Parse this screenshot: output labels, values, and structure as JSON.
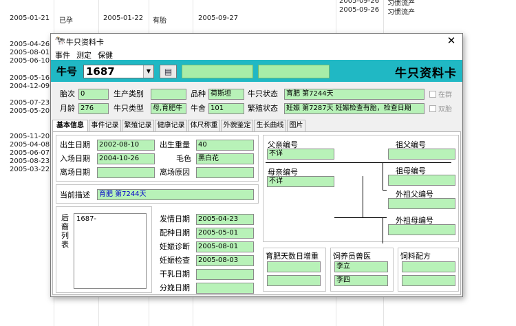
{
  "background": {
    "rows": [
      {
        "a": "2005-01-21",
        "b": "已孕",
        "c": "2005-01-22",
        "d": "有胎",
        "e": "2005-09-27"
      },
      {
        "a": "2005-04-26"
      },
      {
        "a": "2005-08-01"
      },
      {
        "a": "2005-06-10"
      },
      {
        "a": "2005-05-16"
      },
      {
        "a": "2004-12-09"
      },
      {
        "a": "2005-07-23"
      },
      {
        "a": "2005-05-20"
      },
      {
        "a": "2005-11-20"
      },
      {
        "a": "2005-04-08"
      },
      {
        "a": "2005-06-07"
      },
      {
        "a": "2005-08-23"
      },
      {
        "a": "2005-03-22"
      }
    ],
    "top_right": [
      {
        "date": "2005-09-26",
        "text": "习惯流产"
      },
      {
        "date": "2005-09-26",
        "text": "习惯流产"
      }
    ]
  },
  "window": {
    "title": "牛只资料卡",
    "close_glyph": "✕",
    "menu": [
      "事件",
      "测定",
      "保健"
    ]
  },
  "header": {
    "label": "牛号",
    "cow_id": "1687",
    "title": "牛只资料卡",
    "colors": {
      "accent": "#20b8c4",
      "field": "#b8f2b8"
    }
  },
  "info": {
    "parity_label": "胎次",
    "parity": "0",
    "prod_type_label": "生产类别",
    "prod_type": "",
    "breed_label": "品种",
    "breed": "荷斯坦",
    "status_label": "牛只状态",
    "status": "育肥 第7244天",
    "in_herd_label": "在群",
    "age_label": "月龄",
    "age": "276",
    "cow_type_label": "牛只类型",
    "cow_type": "母,育肥牛",
    "barn_label": "牛舍",
    "barn": "101",
    "breed_status_label": "繁殖状态",
    "breed_status": "妊娠 第7287天 妊娠检查有胎，检查日期",
    "twin_label": "双胎"
  },
  "tabs": [
    "基本信息",
    "事件记录",
    "繁殖记录",
    "健康记录",
    "体尺称重",
    "外貌鉴定",
    "生长曲线",
    "图片"
  ],
  "basic": {
    "birth_date_label": "出生日期",
    "birth_date": "2002-08-10",
    "birth_weight_label": "出生重量",
    "birth_weight": "40",
    "entry_date_label": "入场日期",
    "entry_date": "2004-10-26",
    "coat_label": "毛色",
    "coat": "黑白花",
    "leave_date_label": "离场日期",
    "leave_date": "",
    "leave_reason_label": "离场原因",
    "leave_reason": "",
    "current_desc_label": "当前描述",
    "current_desc": "育肥 第7244天",
    "offspring_label": "后裔列表",
    "offspring": [
      "1687-"
    ]
  },
  "repro": {
    "estrus_label": "发情日期",
    "estrus": "2005-04-23",
    "mating_label": "配种日期",
    "mating": "2005-05-01",
    "preg_diag_label": "妊娠诊断",
    "preg_diag": "2005-08-01",
    "preg_check_label": "妊娠检查",
    "preg_check": "2005-08-03",
    "dry_label": "干乳日期",
    "dry": "",
    "calving_label": "分娩日期",
    "calving": ""
  },
  "pedigree": {
    "sire_label": "父亲编号",
    "sire": "不详",
    "dam_label": "母亲编号",
    "dam": "不详",
    "pgs_label": "祖父编号",
    "pgd_label": "祖母编号",
    "mgs_label": "外祖父编号",
    "mgd_label": "外祖母编号"
  },
  "bottom": {
    "gain_label": "育肥天数日增重",
    "keeper_label": "饲养员兽医",
    "keeper": "李立",
    "vet": "李四",
    "feed_label": "饲料配方"
  }
}
